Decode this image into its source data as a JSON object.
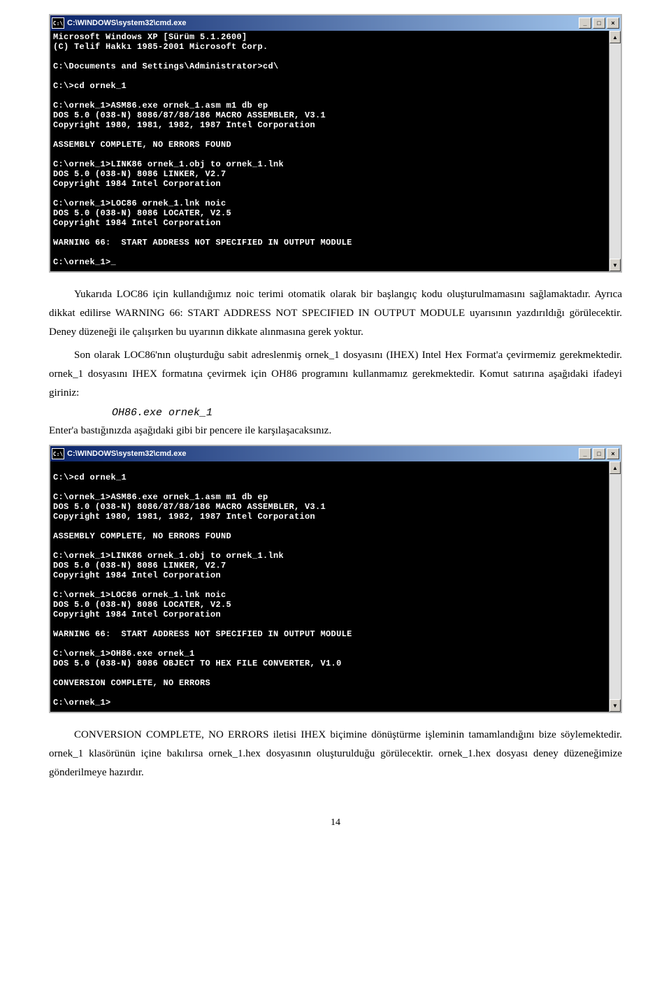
{
  "cmd1": {
    "title": "C:\\WINDOWS\\system32\\cmd.exe",
    "icon_label": "C:\\",
    "btn_min": "_",
    "btn_max": "□",
    "btn_close": "×",
    "scroll_up": "▲",
    "scroll_down": "▼",
    "lines": "Microsoft Windows XP [Sürüm 5.1.2600]\n(C) Telif Hakkı 1985-2001 Microsoft Corp.\n\nC:\\Documents and Settings\\Administrator>cd\\\n\nC:\\>cd ornek_1\n\nC:\\ornek_1>ASM86.exe ornek_1.asm m1 db ep\nDOS 5.0 (038-N) 8086/87/88/186 MACRO ASSEMBLER, V3.1\nCopyright 1980, 1981, 1982, 1987 Intel Corporation\n\nASSEMBLY COMPLETE, NO ERRORS FOUND\n\nC:\\ornek_1>LINK86 ornek_1.obj to ornek_1.lnk\nDOS 5.0 (038-N) 8086 LINKER, V2.7\nCopyright 1984 Intel Corporation\n\nC:\\ornek_1>LOC86 ornek_1.lnk noic\nDOS 5.0 (038-N) 8086 LOCATER, V2.5\nCopyright 1984 Intel Corporation\n\nWARNING 66:  START ADDRESS NOT SPECIFIED IN OUTPUT MODULE\n\nC:\\ornek_1>_"
  },
  "para1": {
    "full": "Yukarıda LOC86 için kullandığımız noic terimi otomatik olarak bir başlangıç kodu oluşturulmamasını sağlamaktadır. Ayrıca dikkat edilirse WARNING 66: START ADDRESS NOT SPECIFIED IN OUTPUT MODULE uyarısının yazdırıldığı görülecektir. Deney düzeneği ile çalışırken bu uyarının dikkate alınmasına gerek yoktur."
  },
  "para2": {
    "full": "Son olarak LOC86'nın oluşturduğu sabit adreslenmiş ornek_1 dosyasını (IHEX) Intel Hex Format'a çevirmemiz gerekmektedir. ornek_1 dosyasını IHEX formatına çevirmek için OH86 programını kullanmamız gerekmektedir. Komut satırına aşağıdaki ifadeyi giriniz:"
  },
  "codeline": "OH86.exe ornek_1",
  "para3": "Enter'a bastığınızda aşağıdaki gibi bir pencere ile karşılaşacaksınız.",
  "cmd2": {
    "title": "C:\\WINDOWS\\system32\\cmd.exe",
    "icon_label": "C:\\",
    "btn_min": "_",
    "btn_max": "□",
    "btn_close": "×",
    "scroll_up": "▲",
    "scroll_down": "▼",
    "lines": "\nC:\\>cd ornek_1\n\nC:\\ornek_1>ASM86.exe ornek_1.asm m1 db ep\nDOS 5.0 (038-N) 8086/87/88/186 MACRO ASSEMBLER, V3.1\nCopyright 1980, 1981, 1982, 1987 Intel Corporation\n\nASSEMBLY COMPLETE, NO ERRORS FOUND\n\nC:\\ornek_1>LINK86 ornek_1.obj to ornek_1.lnk\nDOS 5.0 (038-N) 8086 LINKER, V2.7\nCopyright 1984 Intel Corporation\n\nC:\\ornek_1>LOC86 ornek_1.lnk noic\nDOS 5.0 (038-N) 8086 LOCATER, V2.5\nCopyright 1984 Intel Corporation\n\nWARNING 66:  START ADDRESS NOT SPECIFIED IN OUTPUT MODULE\n\nC:\\ornek_1>OH86.exe ornek_1\nDOS 5.0 (038-N) 8086 OBJECT TO HEX FILE CONVERTER, V1.0\n\nCONVERSION COMPLETE, NO ERRORS\n\nC:\\ornek_1>"
  },
  "para4": {
    "full": "CONVERSION COMPLETE, NO ERRORS iletisi IHEX biçimine dönüştürme işleminin tamamlandığını bize söylemektedir. ornek_1 klasörünün içine bakılırsa ornek_1.hex dosyasının oluşturulduğu görülecektir. ornek_1.hex dosyası deney düzeneğimize gönderilmeye hazırdır."
  },
  "pagenum": "14"
}
